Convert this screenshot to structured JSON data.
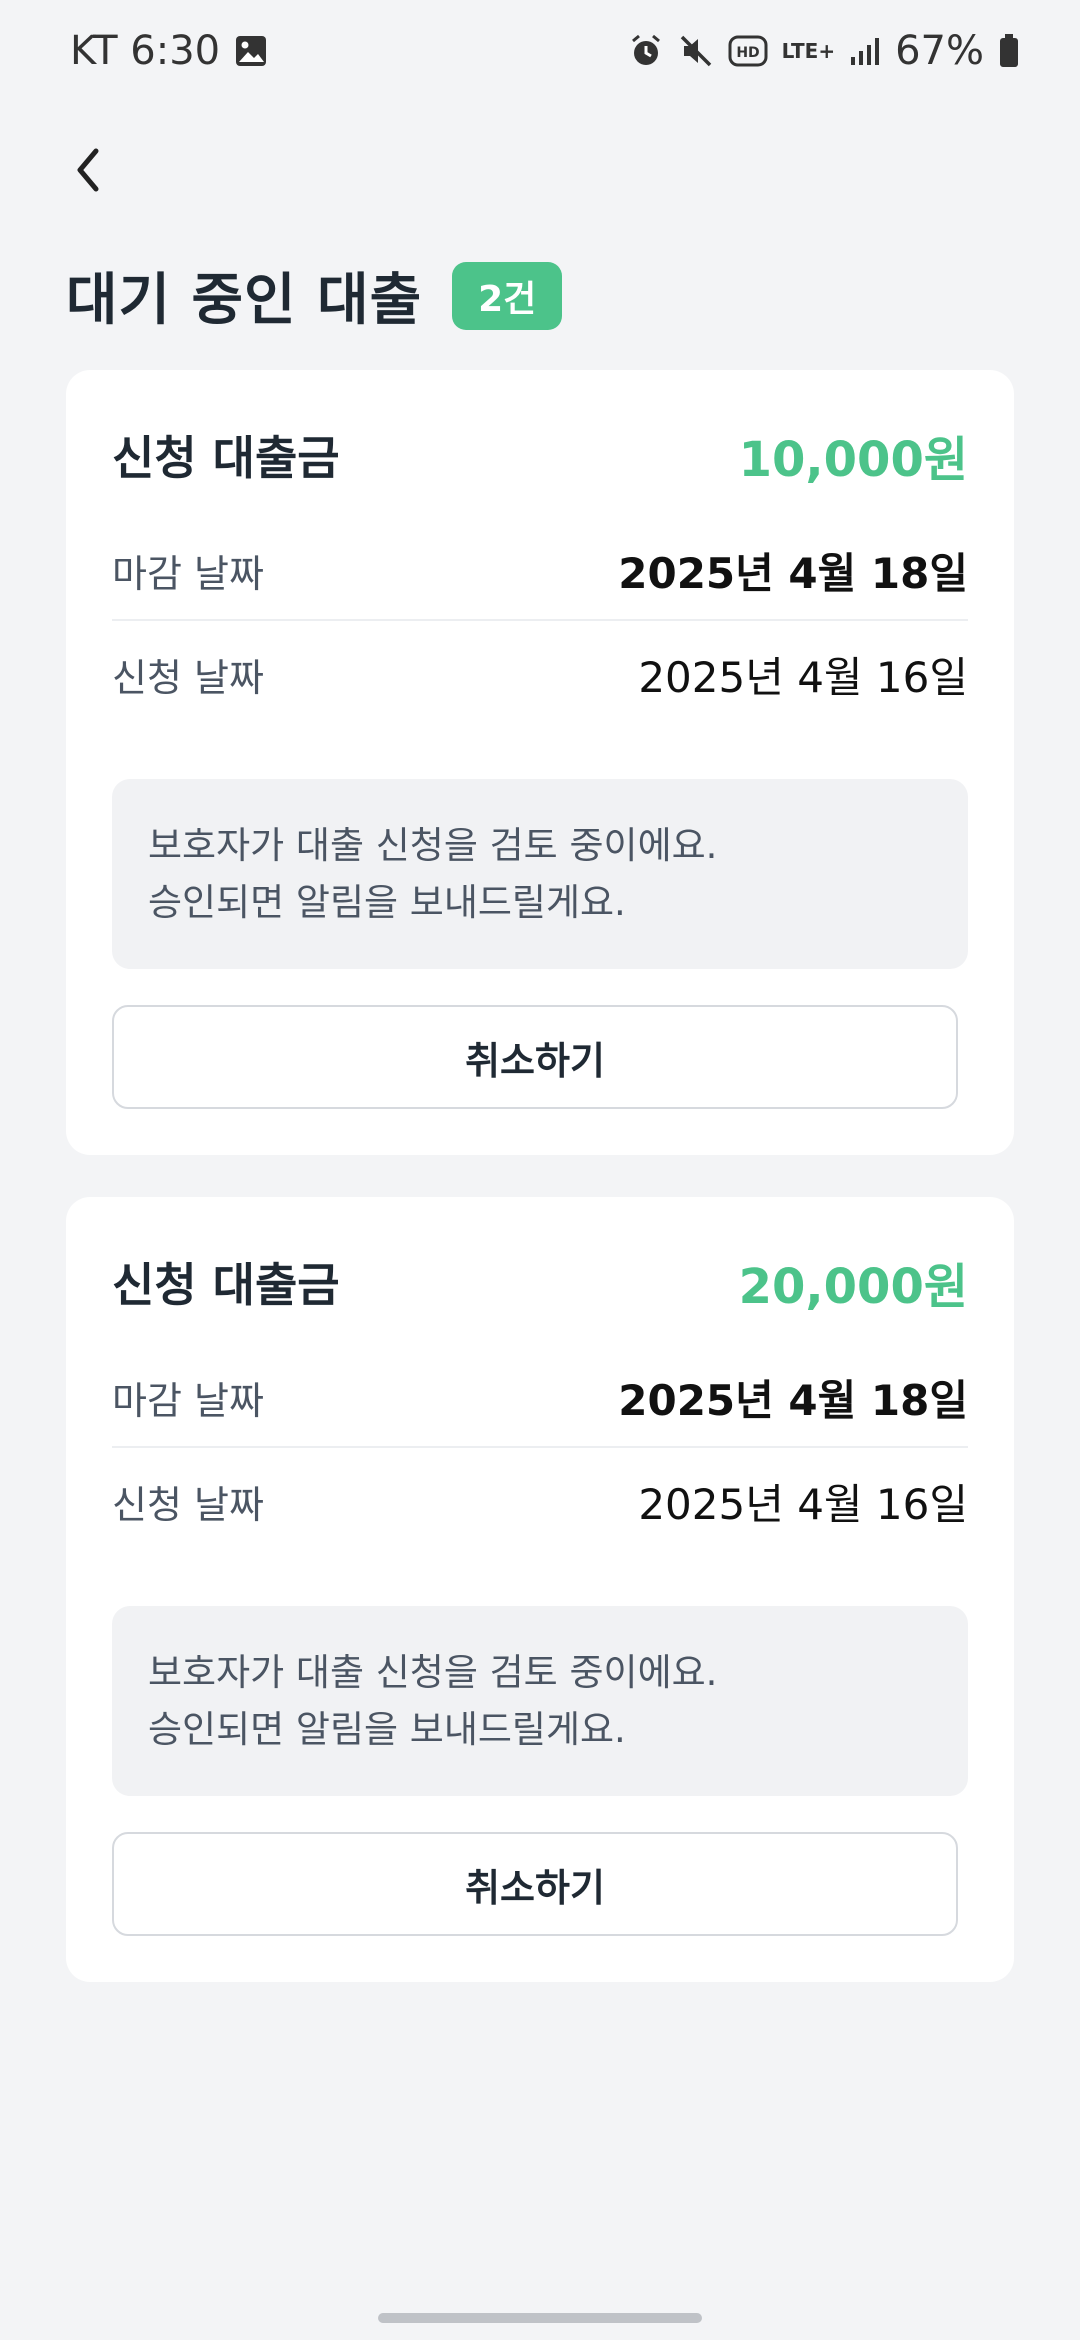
{
  "status_bar": {
    "carrier_time": "KT 6:30",
    "battery": "67%",
    "network": "LTE+"
  },
  "header": {
    "title": "대기 중인 대출",
    "count_badge": "2건"
  },
  "loans": [
    {
      "title": "신청 대출금",
      "amount": "10,000원",
      "deadline_label": "마감 날짜",
      "deadline_value": "2025년 4월 18일",
      "applied_label": "신청 날짜",
      "applied_value": "2025년 4월 16일",
      "notice_line1": "보호자가 대출 신청을 검토 중이에요.",
      "notice_line2": "승인되면 알림을 보내드릴게요.",
      "cancel_label": "취소하기"
    },
    {
      "title": "신청 대출금",
      "amount": "20,000원",
      "deadline_label": "마감 날짜",
      "deadline_value": "2025년 4월 18일",
      "applied_label": "신청 날짜",
      "applied_value": "2025년 4월 16일",
      "notice_line1": "보호자가 대출 신청을 검토 중이에요.",
      "notice_line2": "승인되면 알림을 보내드릴게요.",
      "cancel_label": "취소하기"
    }
  ],
  "colors": {
    "accent": "#4cc38a",
    "background": "#f3f4f6",
    "card": "#ffffff"
  }
}
